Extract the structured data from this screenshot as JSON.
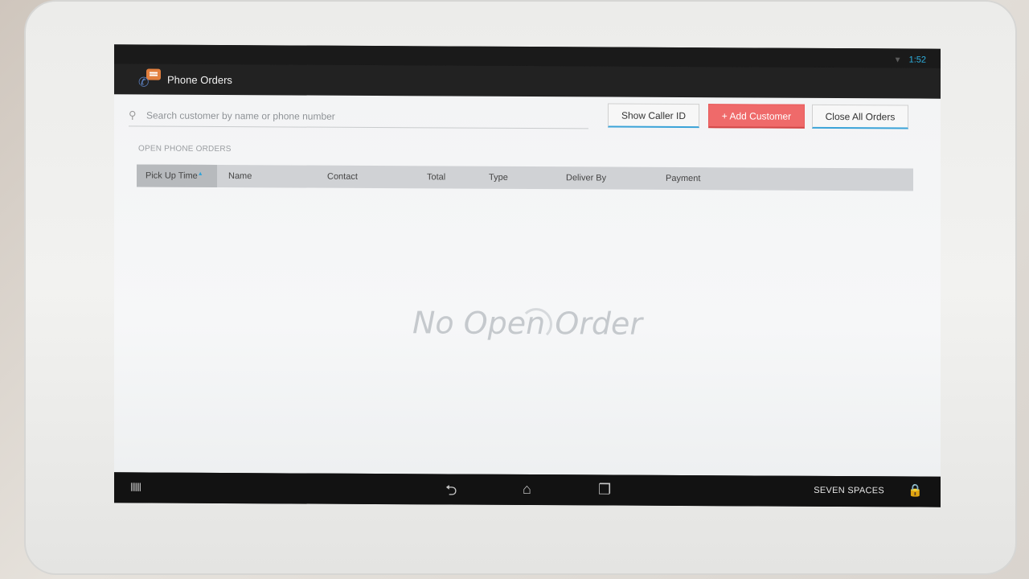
{
  "status_bar": {
    "time": "1:52",
    "wifi_icon": "wifi-icon"
  },
  "action_bar": {
    "title": "Phone Orders",
    "icon": "phone-chat-icon"
  },
  "search": {
    "placeholder": "Search customer by name or phone number",
    "value": ""
  },
  "buttons": {
    "show_caller_id": "Show Caller ID",
    "add_customer": "+ Add Customer",
    "close_all_orders": "Close All Orders"
  },
  "section_label": "OPEN PHONE ORDERS",
  "table": {
    "columns": [
      "Pick Up Time",
      "Name",
      "Contact",
      "Total",
      "Type",
      "Deliver By",
      "Payment"
    ],
    "sorted_column": "Pick Up Time",
    "rows": []
  },
  "empty_state": "No Open Order",
  "nav_bar": {
    "store_name": "SEVEN SPACES"
  },
  "colors": {
    "accent": "#2fa3d8",
    "add_button": "#ef6a6a"
  }
}
